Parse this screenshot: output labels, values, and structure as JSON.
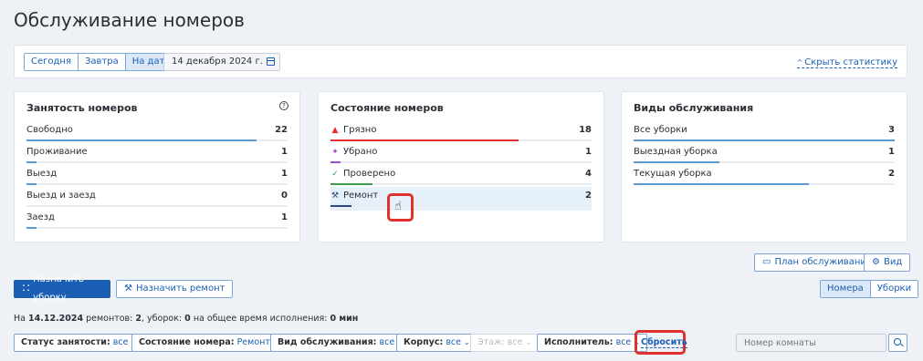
{
  "page": {
    "title": "Обслуживание номеров"
  },
  "date_filter": {
    "tabs": [
      "Сегодня",
      "Завтра",
      "На дату"
    ],
    "active_tab": "На дату",
    "date_value": "14 декабря 2024 г.",
    "hide_stats": "Скрыть статистику"
  },
  "occupancy": {
    "title": "Занятость номеров",
    "rows": [
      {
        "label": "Свободно",
        "value": "22",
        "fraction": 0.88
      },
      {
        "label": "Проживание",
        "value": "1",
        "fraction": 0.04
      },
      {
        "label": "Выезд",
        "value": "1",
        "fraction": 0.04
      },
      {
        "label": "Выезд и заезд",
        "value": "0",
        "fraction": 0
      },
      {
        "label": "Заезд",
        "value": "1",
        "fraction": 0.04
      }
    ]
  },
  "room_state": {
    "title": "Состояние номеров",
    "rows": [
      {
        "label": "Грязно",
        "value": "18",
        "fraction": 0.72,
        "color": "#e0312d",
        "icon": "dirty-icon"
      },
      {
        "label": "Убрано",
        "value": "1",
        "fraction": 0.04,
        "color": "#a64ad1",
        "icon": "cleaned-icon"
      },
      {
        "label": "Проверено",
        "value": "4",
        "fraction": 0.16,
        "color": "#3aa14a",
        "icon": "check-icon"
      },
      {
        "label": "Ремонт",
        "value": "2",
        "fraction": 0.08,
        "color": "#2d4a7a",
        "icon": "repair-icon"
      }
    ]
  },
  "service_types": {
    "title": "Виды обслуживания",
    "rows": [
      {
        "label": "Все уборки",
        "value": "3",
        "fraction": 1.0
      },
      {
        "label": "Выездная уборка",
        "value": "1",
        "fraction": 0.33
      },
      {
        "label": "Текущая уборка",
        "value": "2",
        "fraction": 0.67
      }
    ]
  },
  "actions": {
    "plan": "План обслуживания",
    "view": "Вид",
    "assign_cleaning": "Назначить уборку",
    "assign_repair": "Назначить ремонт",
    "toggle": [
      "Номера",
      "Уборки"
    ],
    "toggle_active": "Номера"
  },
  "info": {
    "prefix": "На",
    "date": "14.12.2024",
    "repairs_label": "ремонтов:",
    "repairs": "2",
    "cleanings_label": ", уборок:",
    "cleanings": "0",
    "time_label": "на общее время исполнения:",
    "time": "0 мин"
  },
  "filters": [
    {
      "key": "Статус занятости:",
      "value": "все"
    },
    {
      "key": "Состояние номера:",
      "value": "Ремонт"
    },
    {
      "key": "Вид обслуживания:",
      "value": "все"
    },
    {
      "key": "Корпус:",
      "value": "все"
    },
    {
      "key": "Этаж:",
      "value": "все",
      "disabled": true
    },
    {
      "key": "Исполнитель:",
      "value": "все"
    }
  ],
  "reset": "Сбросить",
  "search": {
    "placeholder": "Номер комнаты"
  },
  "colors": {
    "accent": "#1a5fb4",
    "highlight_box": "#e0312d"
  }
}
